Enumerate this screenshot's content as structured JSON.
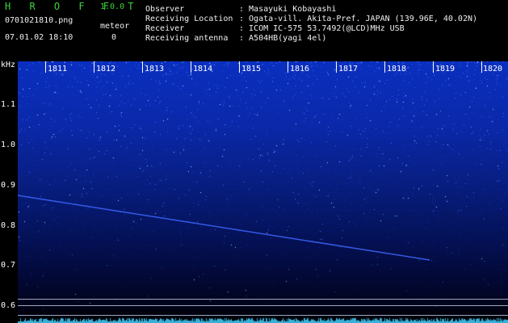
{
  "header": {
    "app_name": "H R O F F T",
    "version": "1.0.0",
    "file_name": "0701021810.png",
    "meteor_label": "meteor",
    "datetime": "07.01.02 18:10",
    "meteor_count": "0",
    "info": [
      {
        "key": "Observer",
        "value": ": Masayuki Kobayashi"
      },
      {
        "key": "Receiving Location",
        "value": ": Ogata-vill. Akita-Pref. JAPAN (139.96E, 40.02N)"
      },
      {
        "key": "Receiver",
        "value": ": ICOM IC-575 53.7492(@LCD)MHz USB"
      },
      {
        "key": "Receiving antenna",
        "value": ": A504HB(yagi 4el)"
      }
    ]
  },
  "spectrogram": {
    "y_unit": "kHz",
    "y_ticks": [
      "1.1",
      "1.0",
      "0.9",
      "0.8",
      "0.7",
      "0.6"
    ],
    "x_ticks": [
      "1811",
      "1812",
      "1813",
      "1814",
      "1815",
      "1816",
      "1817",
      "1818",
      "1819",
      "1820"
    ],
    "colors": {
      "text": "#ffffff",
      "title": "#3fd23f",
      "signal": "#1a3cff",
      "noise_bright": "#9fd8ff",
      "bottom_noise": "#3fd0ff"
    }
  }
}
